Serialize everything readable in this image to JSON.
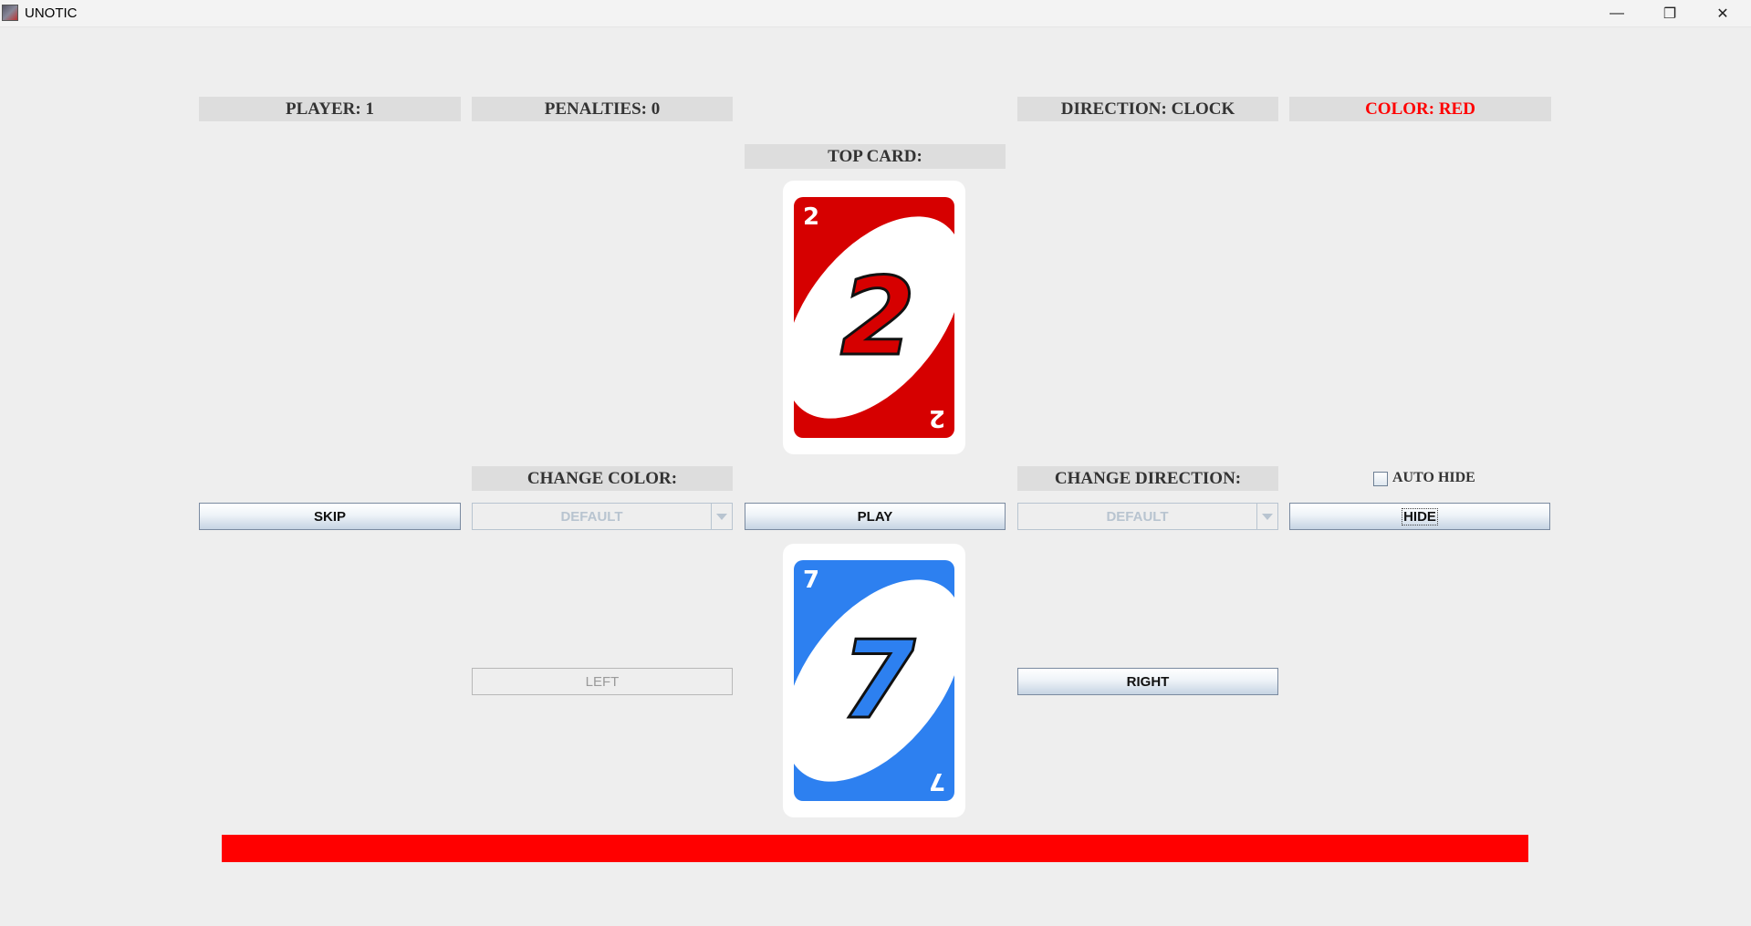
{
  "window": {
    "title": "UNOTIC",
    "minimize_glyph": "—",
    "restore_glyph": "❐",
    "close_glyph": "✕"
  },
  "status": {
    "player": "PLAYER: 1",
    "penalties": "PENALTIES: 0",
    "direction": "DIRECTION: CLOCK",
    "color": "COLOR: RED",
    "color_hex": "#ff0000"
  },
  "top_card": {
    "label": "TOP CARD:",
    "value": "2",
    "color": "red",
    "color_hex": "#d60000"
  },
  "hand_card": {
    "value": "7",
    "color": "blue",
    "color_hex": "#2d80f0"
  },
  "controls": {
    "change_color_label": "CHANGE COLOR:",
    "change_direction_label": "CHANGE DIRECTION:",
    "auto_hide_label": "AUTO HIDE",
    "auto_hide_checked": false,
    "skip_button": "SKIP",
    "color_select_value": "DEFAULT",
    "play_button": "PLAY",
    "direction_select_value": "DEFAULT",
    "hide_button": "HIDE",
    "left_button": "LEFT",
    "right_button": "RIGHT"
  },
  "timer": {
    "fraction_remaining": 1.0,
    "bar_color": "#ff0000"
  }
}
